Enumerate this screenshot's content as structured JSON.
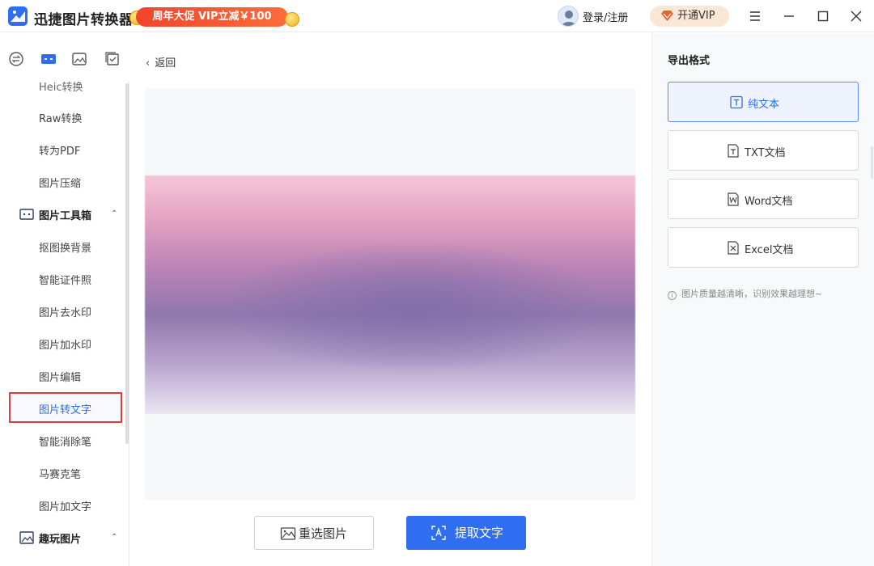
{
  "app": {
    "title": "迅捷图片转换器",
    "promo": "周年大促 VIP立减￥100",
    "login": "登录/注册",
    "vip": "开通VIP"
  },
  "sidebar": {
    "cut_item": "Heic转换",
    "items_top": [
      "Raw转换",
      "转为PDF",
      "图片压缩"
    ],
    "group_toolbox": "图片工具箱",
    "toolbox_items": [
      "抠图换背景",
      "智能证件照",
      "图片去水印",
      "图片加水印",
      "图片编辑",
      "图片转文字",
      "智能消除笔",
      "马赛克笔",
      "图片加文字"
    ],
    "group_fun": "趣玩图片"
  },
  "main": {
    "back": "返回",
    "reselect": "重选图片",
    "extract": "提取文字"
  },
  "export": {
    "title": "导出格式",
    "options": [
      "纯文本",
      "TXT文档",
      "Word文档",
      "Excel文档"
    ],
    "selected": "纯文本",
    "hint": "图片质量越清晰，识别效果越理想~"
  },
  "colors": {
    "accent": "#2f6ef0",
    "highlight_border": "#e0393e",
    "promo": "#f0452b"
  }
}
